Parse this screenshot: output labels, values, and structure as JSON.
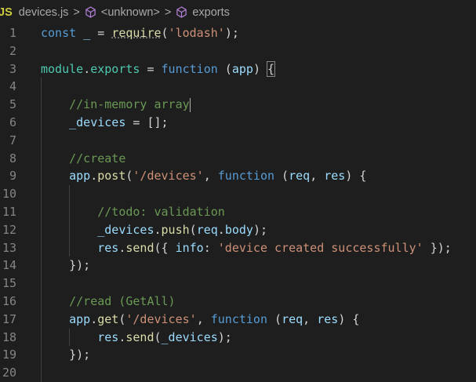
{
  "breadcrumb": {
    "file_icon": "JS",
    "file": "devices.js",
    "items": [
      "<unknown>",
      "exports"
    ],
    "item_icon": "cube-icon"
  },
  "colors": {
    "keyword": "#569cd6",
    "variable": "#9cdcfe",
    "function": "#dcdcaa",
    "string": "#ce9178",
    "comment": "#6a9955",
    "module": "#4ec9b0"
  },
  "lines": [
    [
      [
        "const",
        "kw"
      ],
      [
        " ",
        "pl"
      ],
      [
        "_",
        "var"
      ],
      [
        " = ",
        "pl"
      ],
      [
        "require",
        "fn"
      ],
      [
        "(",
        "pl"
      ],
      [
        "'lodash'",
        "str"
      ],
      [
        ");",
        "pl"
      ]
    ],
    [],
    [
      [
        "module",
        "mod"
      ],
      [
        ".",
        "pl"
      ],
      [
        "exports",
        "mod"
      ],
      [
        " = ",
        "pl"
      ],
      [
        "function",
        "kw"
      ],
      [
        " (",
        "pl"
      ],
      [
        "app",
        "var"
      ],
      [
        ") ",
        "pl"
      ],
      [
        "{",
        "pl"
      ]
    ],
    [],
    [
      [
        "    ",
        "pl"
      ],
      [
        "//in-memory array",
        "cm"
      ]
    ],
    [
      [
        "    ",
        "pl"
      ],
      [
        "_devices",
        "var"
      ],
      [
        " = [];",
        "pl"
      ]
    ],
    [],
    [
      [
        "    ",
        "pl"
      ],
      [
        "//create",
        "cm"
      ]
    ],
    [
      [
        "    ",
        "pl"
      ],
      [
        "app",
        "var"
      ],
      [
        ".",
        "pl"
      ],
      [
        "post",
        "fn"
      ],
      [
        "(",
        "pl"
      ],
      [
        "'/devices'",
        "str"
      ],
      [
        ", ",
        "pl"
      ],
      [
        "function",
        "kw"
      ],
      [
        " (",
        "pl"
      ],
      [
        "req",
        "var"
      ],
      [
        ", ",
        "pl"
      ],
      [
        "res",
        "var"
      ],
      [
        ") {",
        "pl"
      ]
    ],
    [],
    [
      [
        "        ",
        "pl"
      ],
      [
        "//todo: validation",
        "cm"
      ]
    ],
    [
      [
        "        ",
        "pl"
      ],
      [
        "_devices",
        "var"
      ],
      [
        ".",
        "pl"
      ],
      [
        "push",
        "fn"
      ],
      [
        "(",
        "pl"
      ],
      [
        "req",
        "var"
      ],
      [
        ".",
        "pl"
      ],
      [
        "body",
        "var"
      ],
      [
        ");",
        "pl"
      ]
    ],
    [
      [
        "        ",
        "pl"
      ],
      [
        "res",
        "var"
      ],
      [
        ".",
        "pl"
      ],
      [
        "send",
        "fn"
      ],
      [
        "({ ",
        "pl"
      ],
      [
        "info",
        "var"
      ],
      [
        ": ",
        "pl"
      ],
      [
        "'device created successfully'",
        "str"
      ],
      [
        " });",
        "pl"
      ]
    ],
    [
      [
        "    ",
        "pl"
      ],
      [
        "});",
        "pl"
      ]
    ],
    [],
    [
      [
        "    ",
        "pl"
      ],
      [
        "//read (GetAll)",
        "cm"
      ]
    ],
    [
      [
        "    ",
        "pl"
      ],
      [
        "app",
        "var"
      ],
      [
        ".",
        "pl"
      ],
      [
        "get",
        "fn"
      ],
      [
        "(",
        "pl"
      ],
      [
        "'/devices'",
        "str"
      ],
      [
        ", ",
        "pl"
      ],
      [
        "function",
        "kw"
      ],
      [
        " (",
        "pl"
      ],
      [
        "req",
        "var"
      ],
      [
        ", ",
        "pl"
      ],
      [
        "res",
        "var"
      ],
      [
        ") {",
        "pl"
      ]
    ],
    [
      [
        "        ",
        "pl"
      ],
      [
        "res",
        "var"
      ],
      [
        ".",
        "pl"
      ],
      [
        "send",
        "fn"
      ],
      [
        "(",
        "pl"
      ],
      [
        "_devices",
        "var"
      ],
      [
        ");",
        "pl"
      ]
    ],
    [
      [
        "    ",
        "pl"
      ],
      [
        "});",
        "pl"
      ]
    ],
    []
  ]
}
